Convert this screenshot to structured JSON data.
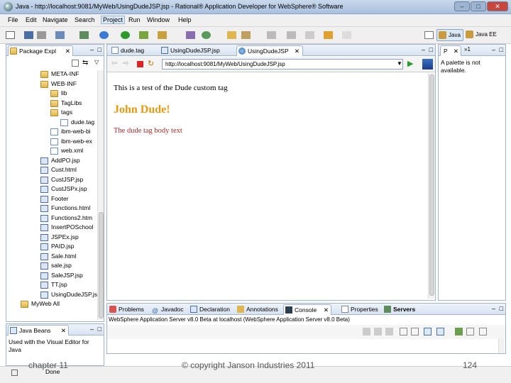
{
  "window": {
    "title": "Java - http://localhost:9081/MyWeb/UsingDudeJSP.jsp - Rational® Application Developer for WebSphere® Software",
    "min_label": "–",
    "max_label": "□",
    "close_label": "✕"
  },
  "menu": [
    "File",
    "Edit",
    "Navigate",
    "Search",
    "Project",
    "Run",
    "Window",
    "Help"
  ],
  "menu_active": "Project",
  "perspectives": {
    "java": "Java",
    "javaee": "Java EE"
  },
  "package_explorer": {
    "tab_label": "Package Expl",
    "items": [
      {
        "label": "META-INF",
        "type": "folder"
      },
      {
        "label": "WEB-INF",
        "type": "folder"
      },
      {
        "label": "lib",
        "type": "folder"
      },
      {
        "label": "TagLibs",
        "type": "folder"
      },
      {
        "label": "tags",
        "type": "folder"
      },
      {
        "label": "dude.tag",
        "type": "file"
      },
      {
        "label": "ibm-web-bi",
        "type": "file"
      },
      {
        "label": "ibm-web-ex",
        "type": "file"
      },
      {
        "label": "web.xml",
        "type": "file"
      },
      {
        "label": "AddPO.jsp",
        "type": "jsp"
      },
      {
        "label": "Cust.html",
        "type": "jsp"
      },
      {
        "label": "CustJSP.jsp",
        "type": "jsp"
      },
      {
        "label": "CustJSPx.jsp",
        "type": "jsp"
      },
      {
        "label": "Footer",
        "type": "jsp"
      },
      {
        "label": "Functions.html",
        "type": "jsp"
      },
      {
        "label": "Functions2.htm",
        "type": "jsp"
      },
      {
        "label": "InsertPOSchool",
        "type": "jsp"
      },
      {
        "label": "JSPEx.jsp",
        "type": "jsp"
      },
      {
        "label": "PAID.jsp",
        "type": "jsp"
      },
      {
        "label": "Sale.html",
        "type": "jsp"
      },
      {
        "label": "sale.jsp",
        "type": "jsp"
      },
      {
        "label": "SaleJSP.jsp",
        "type": "jsp"
      },
      {
        "label": "TT.jsp",
        "type": "jsp"
      },
      {
        "label": "UsingDudeJSP.jsp",
        "type": "jsp"
      }
    ],
    "project_label": "MyWeb All"
  },
  "javabeans": {
    "tab_label": "Java Beans",
    "message": "Used with the Visual Editor for Java"
  },
  "editor": {
    "tabs": [
      "dude.tag",
      "UsingDudeJSP.jsp",
      "UsingDudeJSP"
    ],
    "active_tab": "UsingDudeJSP",
    "url": "http://localhost:9081/MyWeb/UsingDudeJSP.jsp",
    "page": {
      "intro": "This is a test of the Dude custom tag",
      "heading": "John Dude!",
      "body": "The dude tag body text"
    }
  },
  "palette": {
    "tab_label": "P",
    "tab2_label": "»1",
    "message": "A palette is not available."
  },
  "bottom": {
    "tabs": [
      "Problems",
      "Javadoc",
      "Declaration",
      "Annotations",
      "Console",
      "Properties",
      "Servers"
    ],
    "active_tab": "Console",
    "console_header": "WebSphere Application Server v8.0 Beta at localhost (WebSphere Application Server v8.0 Beta)"
  },
  "status": {
    "done": "Done"
  },
  "slide_footer": {
    "chapter": "chapter 11",
    "copyright": "© copyright Janson Industries 2011",
    "page": "124"
  },
  "colors": {
    "heading": "#e59a12",
    "body_text": "#a32b2b",
    "titlebar": "#b7cbe4",
    "close_button": "#c9463d"
  }
}
